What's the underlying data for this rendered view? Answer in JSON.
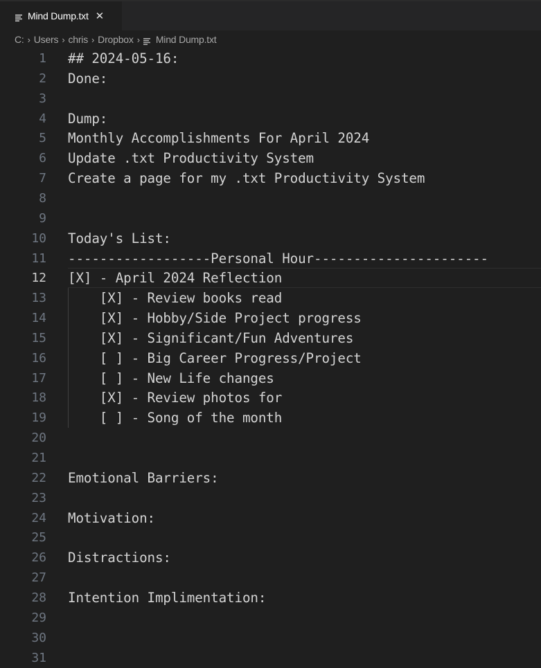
{
  "tab": {
    "label": "Mind Dump.txt",
    "icon": "text-file-icon",
    "close_icon": "close-icon",
    "close_glyph": "✕"
  },
  "breadcrumb": {
    "items": [
      "C:",
      "Users",
      "chris",
      "Dropbox",
      "Mind Dump.txt"
    ],
    "separator": "›"
  },
  "editor": {
    "current_line": 12,
    "lines": [
      {
        "n": "1",
        "text": "## 2024-05-16:"
      },
      {
        "n": "2",
        "text": "Done:"
      },
      {
        "n": "3",
        "text": ""
      },
      {
        "n": "4",
        "text": "Dump:"
      },
      {
        "n": "5",
        "text": "Monthly Accomplishments For April 2024"
      },
      {
        "n": "6",
        "text": "Update .txt Productivity System"
      },
      {
        "n": "7",
        "text": "Create a page for my .txt Productivity System"
      },
      {
        "n": "8",
        "text": ""
      },
      {
        "n": "9",
        "text": ""
      },
      {
        "n": "10",
        "text": "Today's List:"
      },
      {
        "n": "11",
        "text": "------------------Personal Hour----------------------"
      },
      {
        "n": "12",
        "text": "[X] - April 2024 Reflection"
      },
      {
        "n": "13",
        "text": "    [X] - Review books read"
      },
      {
        "n": "14",
        "text": "    [X] - Hobby/Side Project progress"
      },
      {
        "n": "15",
        "text": "    [X] - Significant/Fun Adventures"
      },
      {
        "n": "16",
        "text": "    [ ] - Big Career Progress/Project"
      },
      {
        "n": "17",
        "text": "    [ ] - New Life changes"
      },
      {
        "n": "18",
        "text": "    [X] - Review photos for"
      },
      {
        "n": "19",
        "text": "    [ ] - Song of the month"
      },
      {
        "n": "20",
        "text": ""
      },
      {
        "n": "21",
        "text": ""
      },
      {
        "n": "22",
        "text": "Emotional Barriers:"
      },
      {
        "n": "23",
        "text": ""
      },
      {
        "n": "24",
        "text": "Motivation:"
      },
      {
        "n": "25",
        "text": ""
      },
      {
        "n": "26",
        "text": "Distractions:"
      },
      {
        "n": "27",
        "text": ""
      },
      {
        "n": "28",
        "text": "Intention Implimentation:"
      },
      {
        "n": "29",
        "text": ""
      },
      {
        "n": "30",
        "text": ""
      },
      {
        "n": "31",
        "text": ""
      }
    ]
  },
  "colors": {
    "background": "#1f1f1f",
    "tabbar": "#252526",
    "text": "#d4d4d4",
    "line_number": "#6e7681",
    "line_number_active": "#cccccc"
  }
}
